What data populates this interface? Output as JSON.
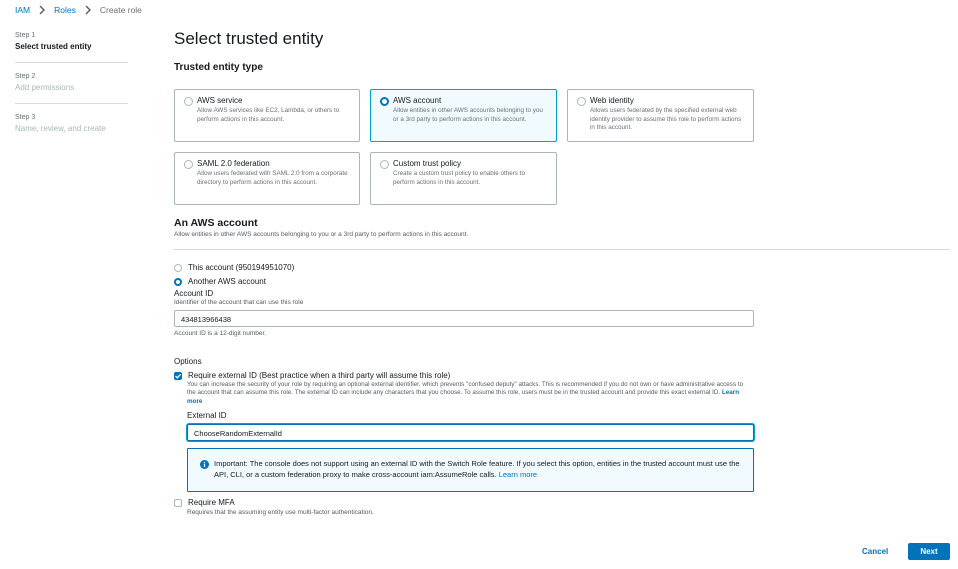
{
  "breadcrumb": {
    "iam": "IAM",
    "roles": "Roles",
    "current": "Create role"
  },
  "steps": [
    {
      "num": "Step 1",
      "title": "Select trusted entity"
    },
    {
      "num": "Step 2",
      "title": "Add permissions"
    },
    {
      "num": "Step 3",
      "title": "Name, review, and create"
    }
  ],
  "page_title": "Select trusted entity",
  "entity_section_title": "Trusted entity type",
  "entity_types": [
    {
      "title": "AWS service",
      "desc": "Allow AWS services like EC2, Lambda, or others to perform actions in this account.",
      "selected": false
    },
    {
      "title": "AWS account",
      "desc": "Allow entities in other AWS accounts belonging to you or a 3rd party to perform actions in this account.",
      "selected": true
    },
    {
      "title": "Web identity",
      "desc": "Allows users federated by the specified external web identity provider to assume this role to perform actions in this account.",
      "selected": false
    },
    {
      "title": "SAML 2.0 federation",
      "desc": "Allow users federated with SAML 2.0 from a corporate directory to perform actions in this account.",
      "selected": false
    },
    {
      "title": "Custom trust policy",
      "desc": "Create a custom trust policy to enable others to perform actions in this account.",
      "selected": false
    }
  ],
  "aws_account": {
    "title": "An AWS account",
    "desc": "Allow entities in other AWS accounts belonging to you or a 3rd party to perform actions in this account.",
    "this_account": "This account (950194951070)",
    "another_account": "Another AWS account",
    "account_id_label": "Account ID",
    "account_id_desc": "Identifier of the account that can use this role",
    "account_id_value": "434813966438",
    "account_id_hint": "Account ID is a 12-digit number."
  },
  "options": {
    "title": "Options",
    "external_id_check": "Require external ID (Best practice when a third party will assume this role)",
    "external_id_desc": "You can increase the security of your role by requiring an optional external identifier, which prevents \"confused deputy\" attacks. This is recommended if you do not own or have administrative access to the account that can assume this role. The external ID can include any characters that you choose. To assume this role, users must be in the trusted account and provide this exact external ID.",
    "learn_more": "Learn more",
    "external_id_label": "External ID",
    "external_id_value": "ChooseRandomExternalId",
    "info_text": "Important: The console does not support using an external ID with the Switch Role feature. If you select this option, entities in the trusted account must use the API, CLI, or a custom federation proxy to make cross-account iam:AssumeRole calls.",
    "info_learn_more": "Learn more",
    "mfa_label": "Require MFA",
    "mfa_desc": "Requires that the assuming entity use multi-factor authentication."
  },
  "footer": {
    "cancel": "Cancel",
    "next": "Next"
  },
  "colors": {
    "accent": "#0073bb",
    "selected_border": "#00a1c9",
    "selected_bg": "#f1faff"
  }
}
